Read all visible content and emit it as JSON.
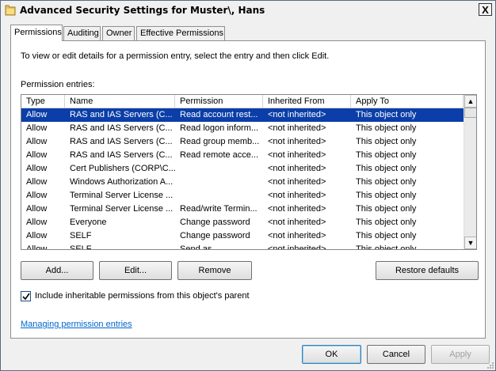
{
  "window": {
    "title": "Advanced Security Settings for Muster\\, Hans",
    "close_label": "X"
  },
  "tabs": [
    {
      "label": "Permissions",
      "active": true
    },
    {
      "label": "Auditing",
      "active": false
    },
    {
      "label": "Owner",
      "active": false
    },
    {
      "label": "Effective Permissions",
      "active": false
    }
  ],
  "permissions": {
    "intro": "To view or edit details for a permission entry, select the entry and then click Edit.",
    "entries_label": "Permission entries:",
    "columns": [
      "Type",
      "Name",
      "Permission",
      "Inherited From",
      "Apply To"
    ],
    "rows": [
      {
        "type": "Allow",
        "name": "RAS and IAS Servers (C...",
        "permission": "Read account rest...",
        "inherited": "<not inherited>",
        "apply": "This object only",
        "selected": true
      },
      {
        "type": "Allow",
        "name": "RAS and IAS Servers (C...",
        "permission": "Read logon inform...",
        "inherited": "<not inherited>",
        "apply": "This object only"
      },
      {
        "type": "Allow",
        "name": "RAS and IAS Servers (C...",
        "permission": "Read group memb...",
        "inherited": "<not inherited>",
        "apply": "This object only"
      },
      {
        "type": "Allow",
        "name": "RAS and IAS Servers (C...",
        "permission": "Read remote acce...",
        "inherited": "<not inherited>",
        "apply": "This object only"
      },
      {
        "type": "Allow",
        "name": "Cert Publishers (CORP\\C...",
        "permission": "",
        "inherited": "<not inherited>",
        "apply": "This object only"
      },
      {
        "type": "Allow",
        "name": "Windows Authorization A...",
        "permission": "",
        "inherited": "<not inherited>",
        "apply": "This object only"
      },
      {
        "type": "Allow",
        "name": "Terminal Server License ...",
        "permission": "",
        "inherited": "<not inherited>",
        "apply": "This object only"
      },
      {
        "type": "Allow",
        "name": "Terminal Server License ...",
        "permission": "Read/write Termin...",
        "inherited": "<not inherited>",
        "apply": "This object only"
      },
      {
        "type": "Allow",
        "name": "Everyone",
        "permission": "Change password",
        "inherited": "<not inherited>",
        "apply": "This object only"
      },
      {
        "type": "Allow",
        "name": "SELF",
        "permission": "Change password",
        "inherited": "<not inherited>",
        "apply": "This object only"
      },
      {
        "type": "Allow",
        "name": "SELF",
        "permission": "Send as",
        "inherited": "<not inherited>",
        "apply": "This object only"
      }
    ],
    "buttons": {
      "add": "Add...",
      "edit": "Edit...",
      "remove": "Remove",
      "restore": "Restore defaults"
    },
    "inherit_checkbox": {
      "label": "Include inheritable permissions from this object's parent",
      "checked": true
    },
    "link": "Managing permission entries"
  },
  "footer": {
    "ok": "OK",
    "cancel": "Cancel",
    "apply": "Apply"
  }
}
